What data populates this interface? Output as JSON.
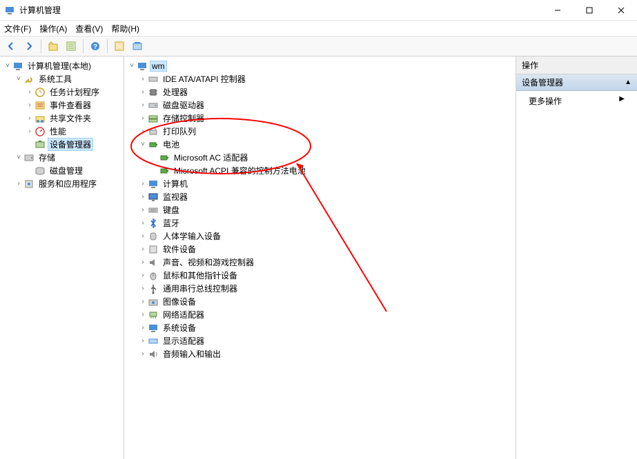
{
  "window": {
    "title": "计算机管理"
  },
  "menu": {
    "file": "文件(F)",
    "action": "操作(A)",
    "view": "查看(V)",
    "help": "帮助(H)"
  },
  "left_tree": {
    "root": "计算机管理(本地)",
    "sys_tools": "系统工具",
    "task_sched": "任务计划程序",
    "event_viewer": "事件查看器",
    "shared_folders": "共享文件夹",
    "performance": "性能",
    "device_mgr": "设备管理器",
    "storage": "存储",
    "disk_mgmt": "磁盘管理",
    "services_apps": "服务和应用程序"
  },
  "device_tree": {
    "host": "wm",
    "ide": "IDE ATA/ATAPI 控制器",
    "cpu": "处理器",
    "disk_drives": "磁盘驱动器",
    "storage_ctrl": "存储控制器",
    "print_queue": "打印队列",
    "battery": "电池",
    "battery_ac": "Microsoft AC 适配器",
    "battery_acpi": "Microsoft ACPI 兼容的控制方法电池",
    "computer": "计算机",
    "monitor": "监视器",
    "keyboard": "键盘",
    "bluetooth": "蓝牙",
    "hid": "人体学输入设备",
    "software_dev": "软件设备",
    "sound": "声音、视频和游戏控制器",
    "mouse": "鼠标和其他指针设备",
    "usb": "通用串行总线控制器",
    "imaging": "图像设备",
    "network": "网络适配器",
    "system_dev": "系统设备",
    "display": "显示适配器",
    "audio_io": "音频输入和输出"
  },
  "actions": {
    "header": "操作",
    "group": "设备管理器",
    "more": "更多操作"
  },
  "glyph": {
    "expanded": "˅",
    "collapsed": "›",
    "tri_up": "▲",
    "tri_right": "▶"
  }
}
